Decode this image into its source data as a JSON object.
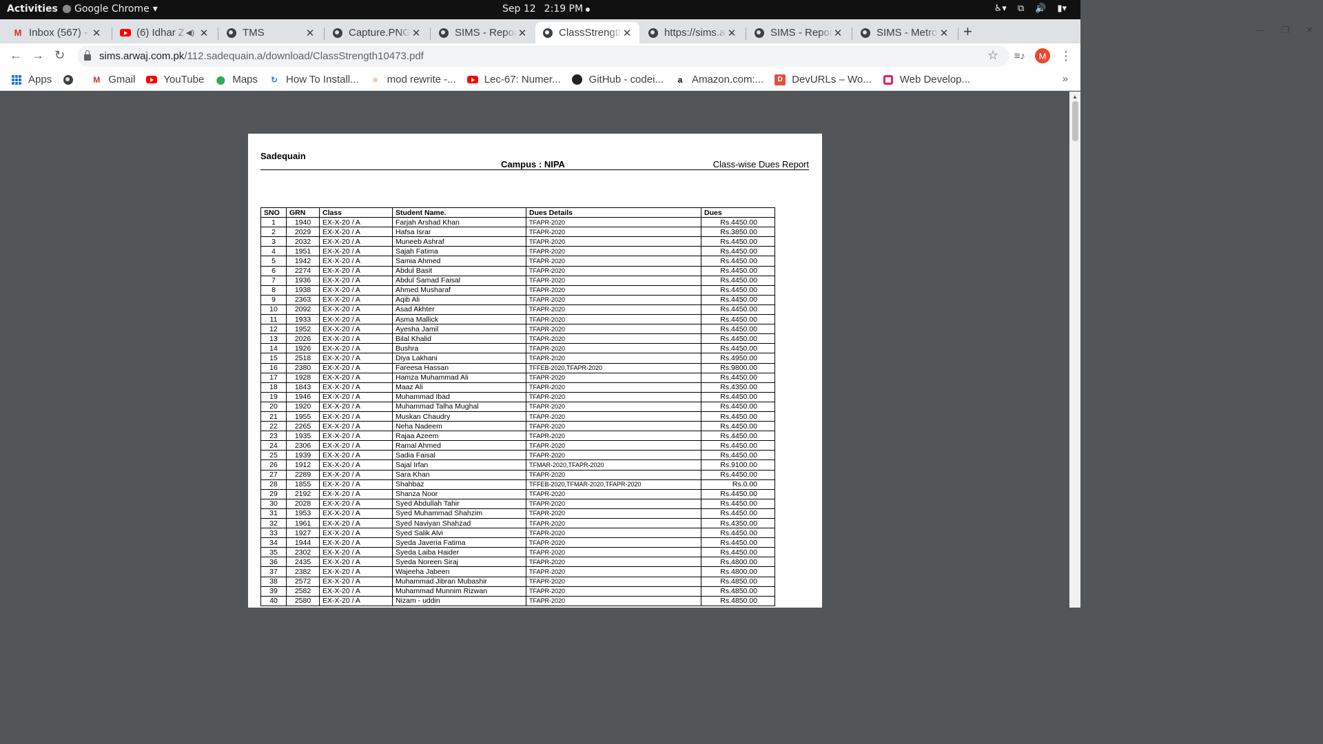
{
  "topbar": {
    "activities": "Activities",
    "app_name": "Google Chrome",
    "date": "Sep 12",
    "time": "2:19 PM"
  },
  "tabs": [
    {
      "label": "Inbox (567) -",
      "icon": "gmail-icon"
    },
    {
      "label": "(6) Idhar Z",
      "icon": "youtube-icon"
    },
    {
      "label": "TMS",
      "icon": "globe-icon"
    },
    {
      "label": "Capture.PNG",
      "icon": "globe-icon"
    },
    {
      "label": "SIMS - Report",
      "icon": "globe-icon"
    },
    {
      "label": "ClassStrength",
      "icon": "globe-icon"
    },
    {
      "label": "https://sims.a",
      "icon": "globe-icon"
    },
    {
      "label": "SIMS - Report",
      "icon": "globe-icon"
    },
    {
      "label": "SIMS - Metro",
      "icon": "globe-icon"
    }
  ],
  "address": {
    "host": "sims.arwaj.com.pk",
    "path": "/112.sadequain.a/download/ClassStrength10473.pdf"
  },
  "profile_initial": "M",
  "bookmarks": [
    {
      "label": "Apps"
    },
    {
      "label": ""
    },
    {
      "label": "Gmail"
    },
    {
      "label": "YouTube"
    },
    {
      "label": "Maps"
    },
    {
      "label": "How To Install..."
    },
    {
      "label": "mod rewrite -..."
    },
    {
      "label": "Lec-67: Numer..."
    },
    {
      "label": "GitHub - codei..."
    },
    {
      "label": "Amazon.com:..."
    },
    {
      "label": "DevURLs – Wo..."
    },
    {
      "label": "Web Develop..."
    }
  ],
  "report": {
    "school": "Sadequain",
    "campus": "Campus : NIPA",
    "title": "Class-wise Dues Report",
    "headers": [
      "SNO",
      "GRN",
      "Class",
      "Student Name.",
      "Dues Details",
      "Dues"
    ],
    "rows": [
      [
        "1",
        "1940",
        "EX-X-20 / A",
        "Farjah Arshad Khan",
        "TFAPR-2020",
        "Rs.4450.00"
      ],
      [
        "2",
        "2029",
        "EX-X-20 / A",
        "Hafsa Israr",
        "TFAPR-2020",
        "Rs.3850.00"
      ],
      [
        "3",
        "2032",
        "EX-X-20 / A",
        "Muneeb Ashraf",
        "TFAPR-2020",
        "Rs.4450.00"
      ],
      [
        "4",
        "1951",
        "EX-X-20 / A",
        "Sajah Fatima",
        "TFAPR-2020",
        "Rs.4450.00"
      ],
      [
        "5",
        "1942",
        "EX-X-20 / A",
        "Samia Ahmed",
        "TFAPR-2020",
        "Rs.4450.00"
      ],
      [
        "6",
        "2274",
        "EX-X-20 / A",
        "Abdul Basit",
        "TFAPR-2020",
        "Rs.4450.00"
      ],
      [
        "7",
        "1936",
        "EX-X-20 / A",
        "Abdul Samad Faisal",
        "TFAPR-2020",
        "Rs.4450.00"
      ],
      [
        "8",
        "1938",
        "EX-X-20 / A",
        "Ahmed Musharaf",
        "TFAPR-2020",
        "Rs.4450.00"
      ],
      [
        "9",
        "2363",
        "EX-X-20 / A",
        "Aqib Ali",
        "TFAPR-2020",
        "Rs.4450.00"
      ],
      [
        "10",
        "2092",
        "EX-X-20 / A",
        "Asad Akhter",
        "TFAPR-2020",
        "Rs.4450.00"
      ],
      [
        "11",
        "1933",
        "EX-X-20 / A",
        "Asma Mallick",
        "TFAPR-2020",
        "Rs.4450.00"
      ],
      [
        "12",
        "1952",
        "EX-X-20 / A",
        "Ayesha Jamil",
        "TFAPR-2020",
        "Rs.4450.00"
      ],
      [
        "13",
        "2026",
        "EX-X-20 / A",
        "Bilal Khalid",
        "TFAPR-2020",
        "Rs.4450.00"
      ],
      [
        "14",
        "1926",
        "EX-X-20 / A",
        "Bushra",
        "TFAPR-2020",
        "Rs.4450.00"
      ],
      [
        "15",
        "2518",
        "EX-X-20 / A",
        "Diya Lakhani",
        "TFAPR-2020",
        "Rs.4950.00"
      ],
      [
        "16",
        "2380",
        "EX-X-20 / A",
        "Fareesa Hassan",
        "TFFEB-2020,TFAPR-2020",
        "Rs.9800.00"
      ],
      [
        "17",
        "1928",
        "EX-X-20 / A",
        "Hamza Muhammad Ali",
        "TFAPR-2020",
        "Rs.4450.00"
      ],
      [
        "18",
        "1843",
        "EX-X-20 / A",
        "Maaz Ali",
        "TFAPR-2020",
        "Rs.4350.00"
      ],
      [
        "19",
        "1946",
        "EX-X-20 / A",
        "Muhammad Ibad",
        "TFAPR-2020",
        "Rs.4450.00"
      ],
      [
        "20",
        "1920",
        "EX-X-20 / A",
        "Muhammad Talha Mughal",
        "TFAPR-2020",
        "Rs.4450.00"
      ],
      [
        "21",
        "1955",
        "EX-X-20 / A",
        "Muskan Chaudry",
        "TFAPR-2020",
        "Rs.4450.00"
      ],
      [
        "22",
        "2265",
        "EX-X-20 / A",
        "Neha Nadeem",
        "TFAPR-2020",
        "Rs.4450.00"
      ],
      [
        "23",
        "1935",
        "EX-X-20 / A",
        "Rajaa Azeem",
        "TFAPR-2020",
        "Rs.4450.00"
      ],
      [
        "24",
        "2306",
        "EX-X-20 / A",
        "Ramal Ahmed",
        "TFAPR-2020",
        "Rs.4450.00"
      ],
      [
        "25",
        "1939",
        "EX-X-20 / A",
        "Sadia Faisal",
        "TFAPR-2020",
        "Rs.4450.00"
      ],
      [
        "26",
        "1912",
        "EX-X-20 / A",
        "Sajal Irfan",
        "TFMAR-2020,TFAPR-2020",
        "Rs.9100.00"
      ],
      [
        "27",
        "2289",
        "EX-X-20 / A",
        "Sara Khan",
        "TFAPR-2020",
        "Rs.4450.00"
      ],
      [
        "28",
        "1855",
        "EX-X-20 / A",
        "Shahbaz",
        "TFFEB-2020,TFMAR-2020,TFAPR-2020",
        "Rs.0.00"
      ],
      [
        "29",
        "2192",
        "EX-X-20 / A",
        "Shanza Noor",
        "TFAPR-2020",
        "Rs.4450.00"
      ],
      [
        "30",
        "2028",
        "EX-X-20 / A",
        "Syed Abdullah Tahir",
        "TFAPR-2020",
        "Rs.4450.00"
      ],
      [
        "31",
        "1953",
        "EX-X-20 / A",
        "Syed Muhammad Shahzim",
        "TFAPR-2020",
        "Rs.4450.00"
      ],
      [
        "32",
        "1961",
        "EX-X-20 / A",
        "Syed Naviyan Shahzad",
        "TFAPR-2020",
        "Rs.4350.00"
      ],
      [
        "33",
        "1927",
        "EX-X-20 / A",
        "Syed Salik Alvi",
        "TFAPR-2020",
        "Rs.4450.00"
      ],
      [
        "34",
        "1944",
        "EX-X-20 / A",
        "Syeda Javeria Fatima",
        "TFAPR-2020",
        "Rs.4450.00"
      ],
      [
        "35",
        "2302",
        "EX-X-20 / A",
        "Syeda Laiba Haider",
        "TFAPR-2020",
        "Rs.4450.00"
      ],
      [
        "36",
        "2435",
        "EX-X-20 / A",
        "Syeda Noreen Siraj",
        "TFAPR-2020",
        "Rs.4800.00"
      ],
      [
        "37",
        "2382",
        "EX-X-20 / A",
        "Wajeeha Jabeen",
        "TFAPR-2020",
        "Rs.4800.00"
      ],
      [
        "38",
        "2572",
        "EX-X-20 / A",
        "Muhammad Jibran Mubashir",
        "TFAPR-2020",
        "Rs.4850.00"
      ],
      [
        "39",
        "2582",
        "EX-X-20 / A",
        "Muhammad Munnim Rizwan",
        "TFAPR-2020",
        "Rs.4850.00"
      ],
      [
        "40",
        "2580",
        "EX-X-20 / A",
        "Nizam - uddin",
        "TFAPR-2020",
        "Rs.4850.00"
      ]
    ]
  }
}
